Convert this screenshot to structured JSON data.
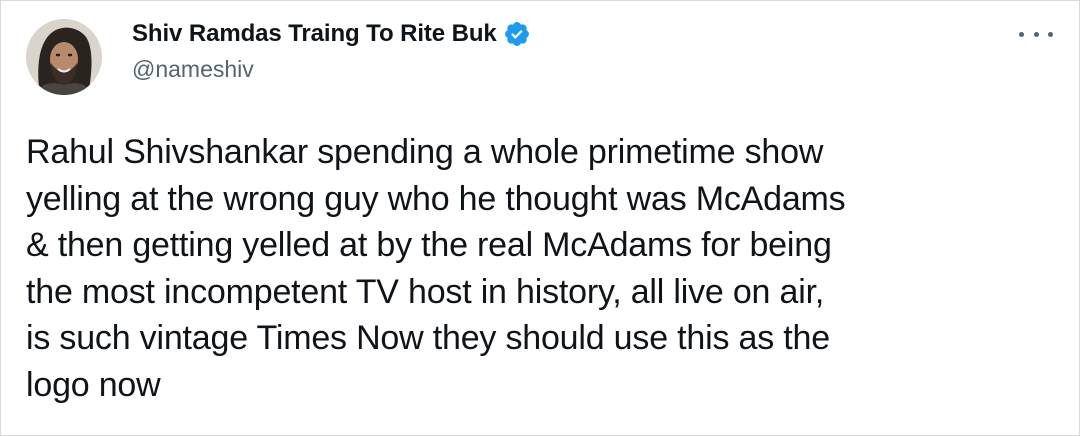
{
  "author": {
    "display_name": "Shiv Ramdas Traing To Rite Buk",
    "handle": "@nameshiv",
    "verified": true,
    "verified_color": "#1d9bf0"
  },
  "tweet": {
    "text_lines": [
      "Rahul Shivshankar spending a whole primetime show",
      "yelling at the wrong guy who he thought was McAdams",
      "& then getting yelled at by the real McAdams for being",
      "the most incompetent TV host in history, all live on air,",
      "is such vintage Times Now they should use this as the",
      "logo now"
    ]
  },
  "icons": {
    "avatar": "user-avatar",
    "verified": "verified-badge-icon",
    "more": "more-options-icon"
  },
  "colors": {
    "text": "#0f1419",
    "secondary_text": "#536471",
    "border": "#d9d9d9"
  }
}
